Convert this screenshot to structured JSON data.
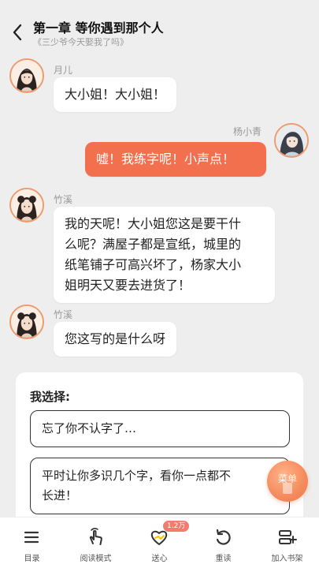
{
  "header": {
    "title": "第一章 等你遇到那个人",
    "subtitle": "《三少爷今天娶我了吗》"
  },
  "messages": [
    {
      "speaker": "月儿",
      "side": "left",
      "text_lines": [
        "大小姐！大小姐！"
      ]
    },
    {
      "speaker": "杨小青",
      "side": "right",
      "text_lines": [
        "嘘！我练字呢！小声点！"
      ]
    },
    {
      "speaker": "竹溪",
      "side": "left",
      "text_lines": [
        "我的天呢！大小姐您这是要干什",
        "么呢？满屋子都是宣纸，城里的",
        "纸笔铺子可高兴坏了，杨家大小",
        "姐明天又要去进货了！"
      ]
    },
    {
      "speaker": "竹溪",
      "side": "left",
      "text_lines": [
        "您这写的是什么呀"
      ]
    }
  ],
  "choice": {
    "title": "我选择:",
    "options": [
      {
        "lines": [
          "忘了你不认字了…"
        ]
      },
      {
        "lines": [
          "平时让你多识几个字，看你一点都不",
          "长进！"
        ]
      }
    ]
  },
  "float_menu": {
    "label": "菜单"
  },
  "bottom_nav": [
    {
      "label": "目录",
      "icon": "list-icon"
    },
    {
      "label": "阅读模式",
      "icon": "tap-hand-icon"
    },
    {
      "label": "送心",
      "icon": "heart-icon",
      "badge": "1.2万"
    },
    {
      "label": "重读",
      "icon": "replay-icon"
    },
    {
      "label": "加入书架",
      "icon": "add-bookshelf-icon"
    }
  ],
  "colors": {
    "background": "#eeeeee",
    "self_bubble": "#f3704f",
    "avatar_ring": "#ef9a6d",
    "badge": "#f37a6d"
  }
}
